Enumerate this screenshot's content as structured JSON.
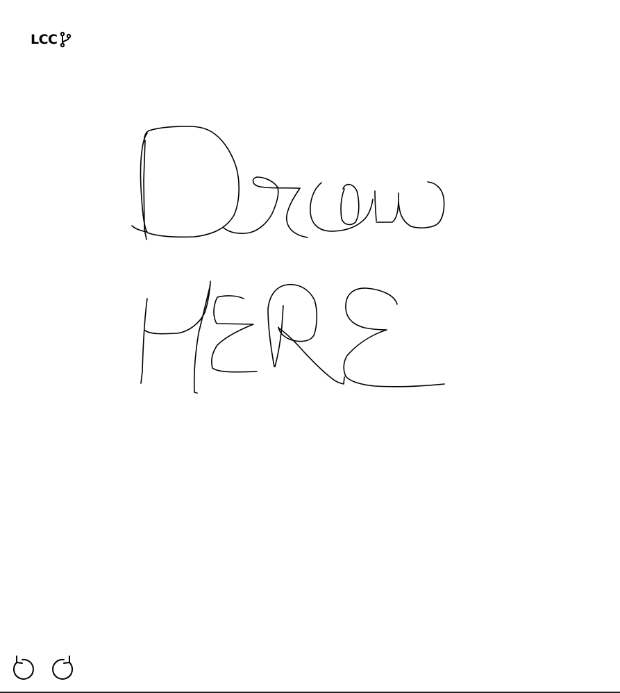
{
  "app": {
    "logo_text": "LCC",
    "logo_icon": "git-branch-icon"
  },
  "canvas": {
    "stroke_color": "#000000",
    "drawing_text": "Draw HERE"
  },
  "toolbar": {
    "undo_icon": "undo-icon",
    "redo_icon": "redo-icon"
  },
  "colors": {
    "background": "#ffffff",
    "ink": "#000000"
  }
}
